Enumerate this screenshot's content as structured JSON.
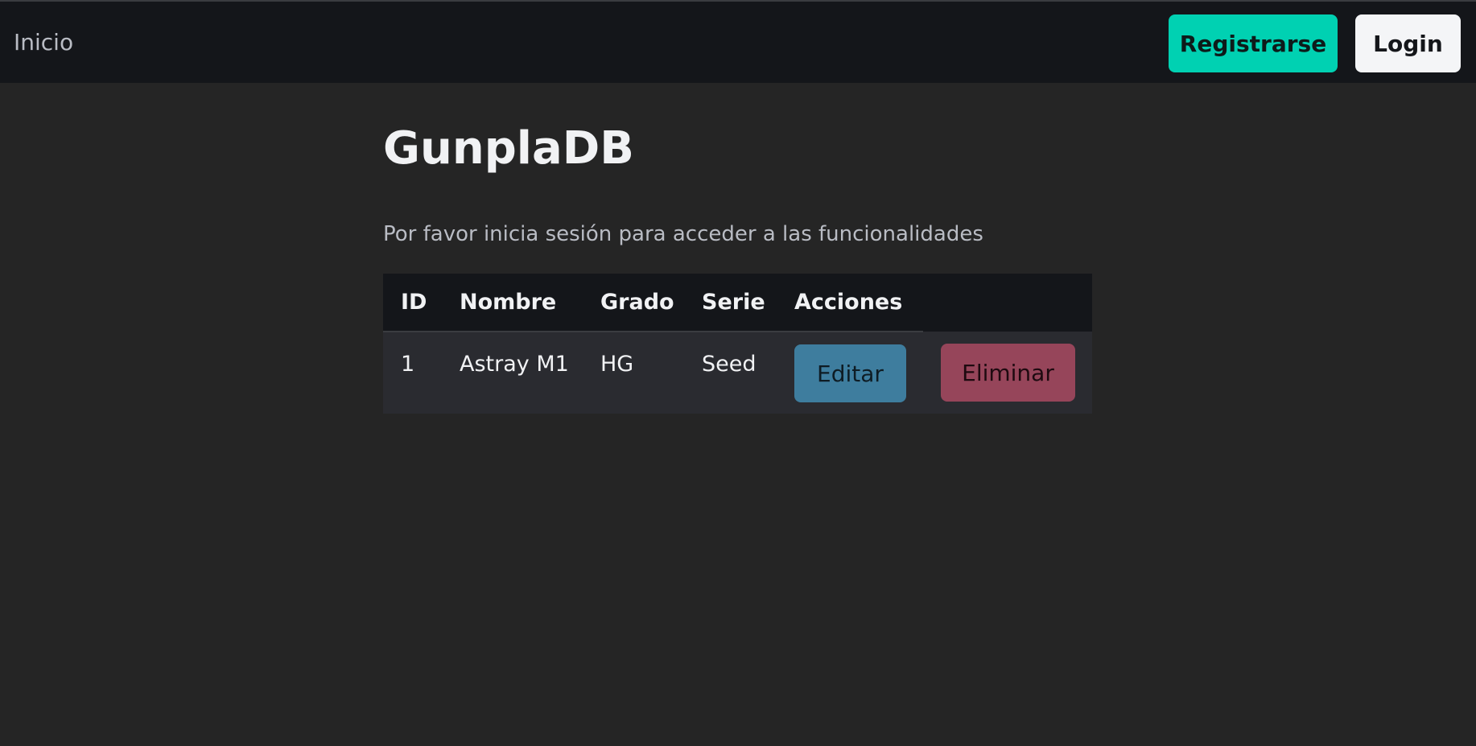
{
  "nav": {
    "home_label": "Inicio",
    "register_label": "Registrarse",
    "login_label": "Login"
  },
  "page": {
    "title": "GunplaDB",
    "subtitle": "Por favor inicia sesión para acceder a las funcionalidades"
  },
  "table": {
    "headers": [
      "ID",
      "Nombre",
      "Grado",
      "Serie",
      "Acciones"
    ],
    "rows": [
      {
        "id": "1",
        "nombre": "Astray M1",
        "grado": "HG",
        "serie": "Seed",
        "edit_label": "Editar",
        "delete_label": "Eliminar"
      }
    ]
  },
  "colors": {
    "accent": "#00d1b2",
    "edit": "#3e7d9e",
    "delete": "#96455a",
    "background": "#252525",
    "navbar": "#14161a"
  }
}
